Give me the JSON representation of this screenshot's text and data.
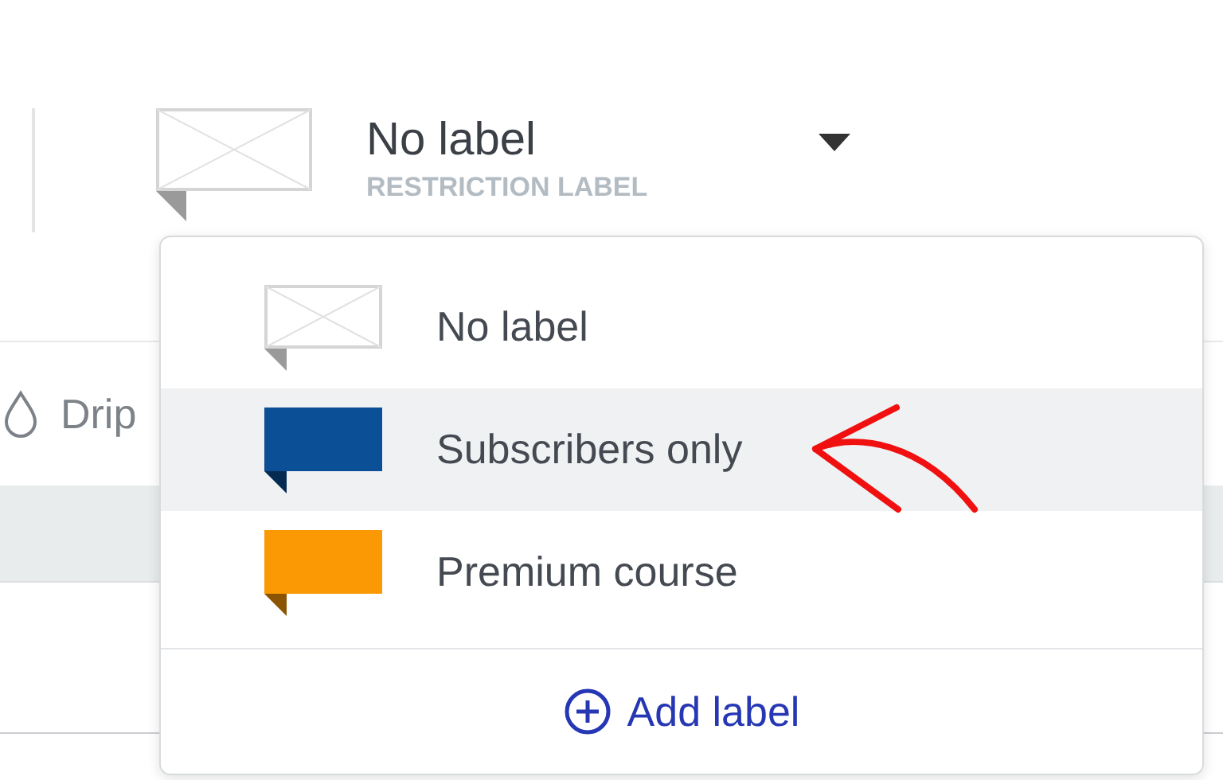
{
  "selector": {
    "value": "No label",
    "caption": "RESTRICTION LABEL",
    "kind": "empty"
  },
  "tabs": [
    {
      "label": "Drip"
    }
  ],
  "menu": {
    "items": [
      {
        "label": "No label",
        "kind": "empty",
        "selected": false
      },
      {
        "label": "Subscribers only",
        "kind": "color",
        "color": "#0b4f96",
        "selected": true
      },
      {
        "label": "Premium course",
        "kind": "color",
        "color": "#fb9904",
        "selected": false
      }
    ],
    "action": "Add label"
  }
}
